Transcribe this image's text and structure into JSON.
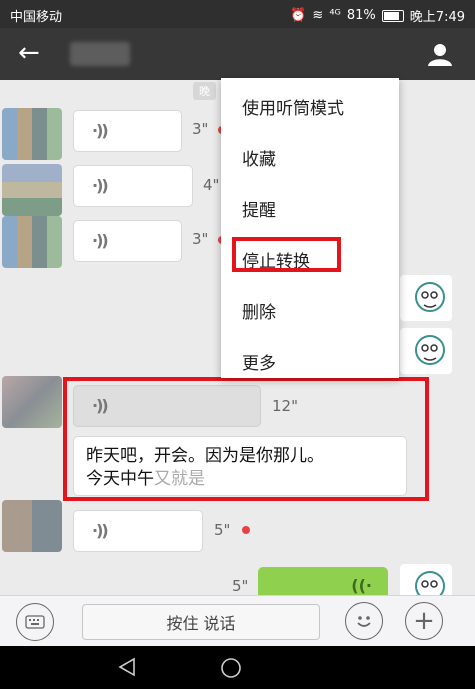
{
  "status": {
    "carrier": "中国移动",
    "battery": "81%",
    "time": "晚上7:49",
    "signal": "⁴ᴳ"
  },
  "chat": {
    "time_divider": "晚",
    "messages": [
      {
        "duration": "3\"",
        "unread": true
      },
      {
        "duration": "4\"",
        "unread": false
      },
      {
        "duration": "3\"",
        "unread": true
      },
      {
        "duration": "12\"",
        "unread": false
      },
      {
        "duration": "5\"",
        "unread": true
      },
      {
        "duration": "5\"",
        "unread": false
      }
    ],
    "transcript_main": "昨天吧，开会。因为是你那儿。",
    "transcript_line2": "今天中午",
    "transcript_faded": "又就是"
  },
  "menu": {
    "items": [
      {
        "label": "使用听筒模式"
      },
      {
        "label": "收藏"
      },
      {
        "label": "提醒"
      },
      {
        "label": "停止转换"
      },
      {
        "label": "删除"
      },
      {
        "label": "更多"
      }
    ]
  },
  "input": {
    "hold_to_talk": "按住 说话"
  },
  "colors": {
    "highlight": "#e4141c",
    "sent_bubble": "#8fd14f",
    "titlebar": "#373737"
  },
  "icons": [
    "back-arrow-icon",
    "contact-icon",
    "voice-icon",
    "keyboard-icon",
    "emoji-icon",
    "plus-icon",
    "back-nav-icon",
    "home-nav-icon"
  ]
}
